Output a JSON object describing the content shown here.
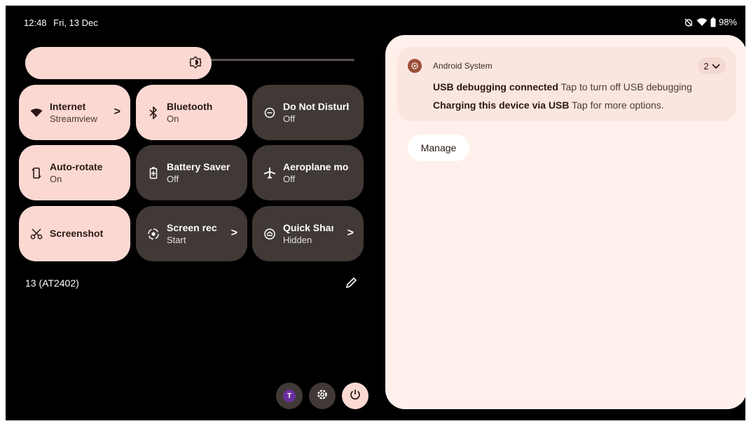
{
  "status_bar": {
    "time": "12:48",
    "date": "Fri, 13 Dec",
    "battery": "98%",
    "icons": [
      "alarm-off-icon",
      "wifi-icon",
      "battery-icon"
    ]
  },
  "brightness": {
    "level": 0.55,
    "icon": "brightness-icon"
  },
  "tiles": [
    {
      "label": "Internet",
      "sub": "Streamview",
      "state": "on",
      "icon": "wifi-icon",
      "chevron": ">"
    },
    {
      "label": "Bluetooth",
      "sub": "On",
      "state": "on",
      "icon": "bluetooth-icon"
    },
    {
      "label": "Do Not Disturb",
      "sub": "Off",
      "state": "off",
      "icon": "do-not-disturb-icon"
    },
    {
      "label": "Auto-rotate",
      "sub": "On",
      "state": "on",
      "icon": "auto-rotate-icon"
    },
    {
      "label": "Battery Saver",
      "sub": "Off",
      "state": "off",
      "icon": "battery-saver-icon"
    },
    {
      "label": "Aeroplane mode",
      "sub": "Off",
      "state": "off",
      "icon": "airplane-icon"
    },
    {
      "label": "Screenshot",
      "sub": "",
      "state": "on",
      "icon": "screenshot-icon"
    },
    {
      "label": "Screen record",
      "sub": "Start",
      "state": "off",
      "icon": "screen-record-icon",
      "chevron": ">"
    },
    {
      "label": "Quick Share",
      "sub": "Hidden",
      "state": "off",
      "icon": "quick-share-icon",
      "chevron": ">"
    }
  ],
  "build_number": "13 (AT2402)",
  "user_avatar_letter": "T",
  "notification": {
    "app_name": "Android System",
    "count": "2",
    "lines": [
      {
        "title": "USB debugging connected",
        "text": "Tap to turn off USB debugging"
      },
      {
        "title": "Charging this device via USB",
        "text": "Tap for more options."
      }
    ],
    "manage_label": "Manage"
  },
  "colors": {
    "background": "#000000",
    "tile_on": "#fbd9d2",
    "tile_off": "#403936",
    "panel": "#fff0eb",
    "app_icon": "#9c4f39",
    "avatar": "#6b2fa0"
  }
}
